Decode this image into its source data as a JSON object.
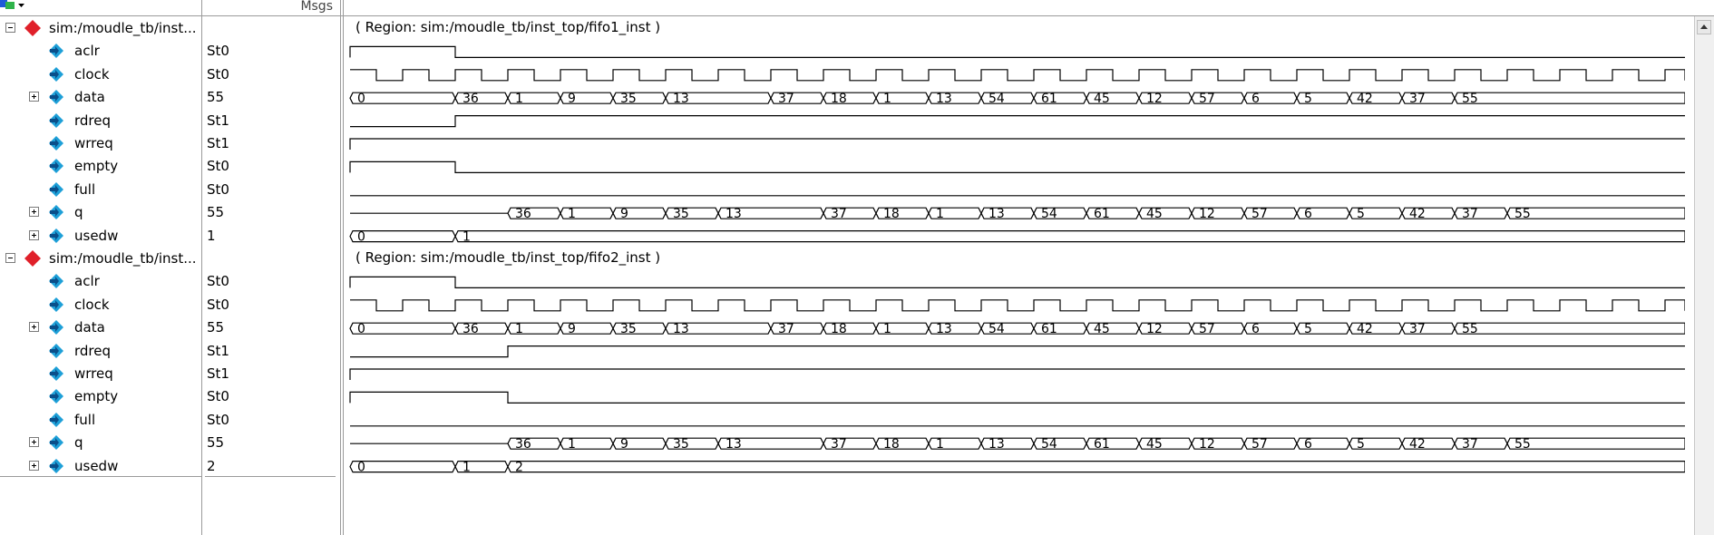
{
  "toolbar": {
    "icon": "wave-color-icon",
    "msgs_header": "Msgs"
  },
  "colors": {
    "wave": "#000000",
    "grid": "#9a9a9a",
    "group_icon": "#e0202a",
    "signal_icon": "#1ea0d8"
  },
  "groups": [
    {
      "name": "sim:/moudle_tb/inst...",
      "region": "( Region: sim:/moudle_tb/inst_top/fifo1_inst )",
      "signals": [
        {
          "name": "aclr",
          "value": "St0",
          "expandable": false,
          "kind": "bit",
          "transitions": [
            [
              0,
              1
            ],
            [
              2,
              0
            ]
          ]
        },
        {
          "name": "clock",
          "value": "St0",
          "expandable": false,
          "kind": "clock"
        },
        {
          "name": "data",
          "value": "55",
          "expandable": true,
          "kind": "bus",
          "segments": [
            [
              0,
              "0"
            ],
            [
              2,
              "36"
            ],
            [
              3,
              "1"
            ],
            [
              4,
              "9"
            ],
            [
              5,
              "35"
            ],
            [
              6,
              "13"
            ],
            [
              8,
              "37"
            ],
            [
              9,
              "18"
            ],
            [
              10,
              "1"
            ],
            [
              11,
              "13"
            ],
            [
              12,
              "54"
            ],
            [
              13,
              "61"
            ],
            [
              14,
              "45"
            ],
            [
              15,
              "12"
            ],
            [
              16,
              "57"
            ],
            [
              17,
              "6"
            ],
            [
              18,
              "5"
            ],
            [
              19,
              "42"
            ],
            [
              20,
              "37"
            ],
            [
              21,
              "55"
            ]
          ]
        },
        {
          "name": "rdreq",
          "value": "St1",
          "expandable": false,
          "kind": "bit",
          "transitions": [
            [
              0,
              0
            ],
            [
              2,
              1
            ]
          ]
        },
        {
          "name": "wrreq",
          "value": "St1",
          "expandable": false,
          "kind": "bit",
          "transitions": [
            [
              0,
              1
            ]
          ]
        },
        {
          "name": "empty",
          "value": "St0",
          "expandable": false,
          "kind": "bit",
          "transitions": [
            [
              0,
              1
            ],
            [
              2,
              0
            ]
          ]
        },
        {
          "name": "full",
          "value": "St0",
          "expandable": false,
          "kind": "bit",
          "transitions": [
            [
              0,
              0
            ]
          ]
        },
        {
          "name": "q",
          "value": "55",
          "expandable": true,
          "kind": "bus",
          "segments": [
            [
              0,
              ""
            ],
            [
              3,
              "36"
            ],
            [
              4,
              "1"
            ],
            [
              5,
              "9"
            ],
            [
              6,
              "35"
            ],
            [
              7,
              "13"
            ],
            [
              9,
              "37"
            ],
            [
              10,
              "18"
            ],
            [
              11,
              "1"
            ],
            [
              12,
              "13"
            ],
            [
              13,
              "54"
            ],
            [
              14,
              "61"
            ],
            [
              15,
              "45"
            ],
            [
              16,
              "12"
            ],
            [
              17,
              "57"
            ],
            [
              18,
              "6"
            ],
            [
              19,
              "5"
            ],
            [
              20,
              "42"
            ],
            [
              21,
              "37"
            ],
            [
              22,
              "55"
            ]
          ]
        },
        {
          "name": "usedw",
          "value": "1",
          "expandable": true,
          "kind": "bus",
          "segments": [
            [
              0,
              "0"
            ],
            [
              2,
              "1"
            ]
          ]
        }
      ]
    },
    {
      "name": "sim:/moudle_tb/inst...",
      "region": "( Region: sim:/moudle_tb/inst_top/fifo2_inst )",
      "signals": [
        {
          "name": "aclr",
          "value": "St0",
          "expandable": false,
          "kind": "bit",
          "transitions": [
            [
              0,
              1
            ],
            [
              2,
              0
            ]
          ]
        },
        {
          "name": "clock",
          "value": "St0",
          "expandable": false,
          "kind": "clock"
        },
        {
          "name": "data",
          "value": "55",
          "expandable": true,
          "kind": "bus",
          "segments": [
            [
              0,
              "0"
            ],
            [
              2,
              "36"
            ],
            [
              3,
              "1"
            ],
            [
              4,
              "9"
            ],
            [
              5,
              "35"
            ],
            [
              6,
              "13"
            ],
            [
              8,
              "37"
            ],
            [
              9,
              "18"
            ],
            [
              10,
              "1"
            ],
            [
              11,
              "13"
            ],
            [
              12,
              "54"
            ],
            [
              13,
              "61"
            ],
            [
              14,
              "45"
            ],
            [
              15,
              "12"
            ],
            [
              16,
              "57"
            ],
            [
              17,
              "6"
            ],
            [
              18,
              "5"
            ],
            [
              19,
              "42"
            ],
            [
              20,
              "37"
            ],
            [
              21,
              "55"
            ]
          ]
        },
        {
          "name": "rdreq",
          "value": "St1",
          "expandable": false,
          "kind": "bit",
          "transitions": [
            [
              0,
              0
            ],
            [
              3,
              1
            ]
          ]
        },
        {
          "name": "wrreq",
          "value": "St1",
          "expandable": false,
          "kind": "bit",
          "transitions": [
            [
              0,
              1
            ]
          ]
        },
        {
          "name": "empty",
          "value": "St0",
          "expandable": false,
          "kind": "bit",
          "transitions": [
            [
              0,
              1
            ],
            [
              3,
              0
            ]
          ]
        },
        {
          "name": "full",
          "value": "St0",
          "expandable": false,
          "kind": "bit",
          "transitions": [
            [
              0,
              0
            ]
          ]
        },
        {
          "name": "q",
          "value": "55",
          "expandable": true,
          "kind": "bus",
          "segments": [
            [
              0,
              ""
            ],
            [
              3,
              "36"
            ],
            [
              4,
              "1"
            ],
            [
              5,
              "9"
            ],
            [
              6,
              "35"
            ],
            [
              7,
              "13"
            ],
            [
              9,
              "37"
            ],
            [
              10,
              "18"
            ],
            [
              11,
              "1"
            ],
            [
              12,
              "13"
            ],
            [
              13,
              "54"
            ],
            [
              14,
              "61"
            ],
            [
              15,
              "45"
            ],
            [
              16,
              "12"
            ],
            [
              17,
              "57"
            ],
            [
              18,
              "6"
            ],
            [
              19,
              "5"
            ],
            [
              20,
              "42"
            ],
            [
              21,
              "37"
            ],
            [
              22,
              "55"
            ]
          ]
        },
        {
          "name": "usedw",
          "value": "2",
          "expandable": true,
          "kind": "bus",
          "segments": [
            [
              0,
              "0"
            ],
            [
              2,
              "1"
            ],
            [
              3,
              "2"
            ]
          ]
        }
      ]
    }
  ],
  "timeline": {
    "clock_cycles": 26
  }
}
